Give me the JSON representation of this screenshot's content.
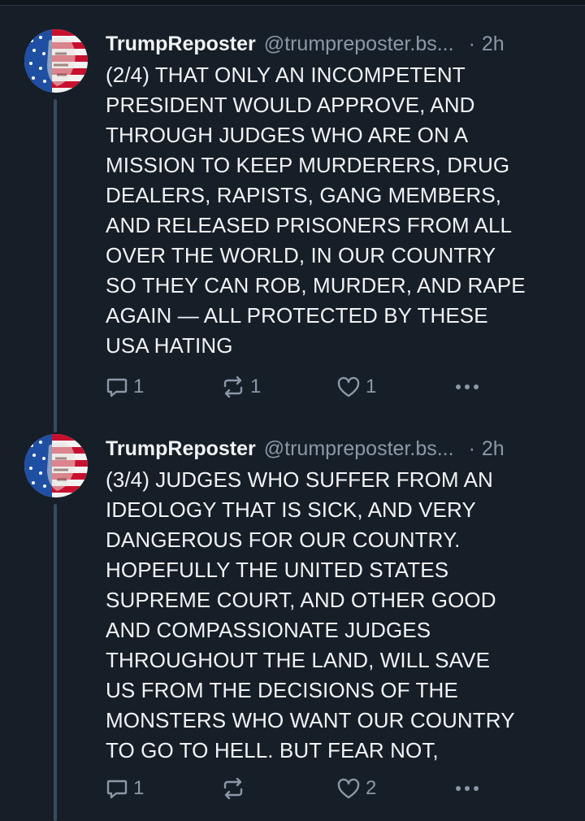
{
  "posts": [
    {
      "author": {
        "display_name": "TrumpReposter",
        "handle": "@trumpreposter.bs...",
        "avatar": "flag-portrait-avatar"
      },
      "separator": "·",
      "time": "2h",
      "text": "(2/4) THAT ONLY AN INCOMPETENT\nPRESIDENT WOULD APPROVE, AND\nTHROUGH JUDGES WHO ARE ON A\nMISSION TO KEEP MURDERERS, DRUG\nDEALERS, RAPISTS, GANG MEMBERS,\nAND RELEASED PRISONERS FROM ALL\nOVER THE WORLD, IN OUR COUNTRY\nSO THEY CAN ROB, MURDER, AND RAPE\nAGAIN — ALL PROTECTED BY THESE\nUSA HATING",
      "actions": {
        "replies": "1",
        "reposts": "1",
        "likes": "1",
        "more_icon": "more-horizontal-icon"
      }
    },
    {
      "author": {
        "display_name": "TrumpReposter",
        "handle": "@trumpreposter.bs...",
        "avatar": "flag-portrait-avatar"
      },
      "separator": "·",
      "time": "2h",
      "text": "(3/4) JUDGES WHO SUFFER FROM AN\nIDEOLOGY THAT IS SICK, AND VERY\nDANGEROUS FOR OUR COUNTRY.\nHOPEFULLY THE UNITED STATES\nSUPREME COURT, AND OTHER GOOD\nAND COMPASSIONATE JUDGES\nTHROUGHOUT THE LAND, WILL SAVE\nUS FROM THE DECISIONS OF THE\nMONSTERS WHO WANT OUR COUNTRY\nTO GO TO HELL. BUT FEAR NOT,",
      "actions": {
        "replies": "1",
        "reposts": "",
        "likes": "2",
        "more_icon": "more-horizontal-icon"
      }
    }
  ],
  "colors": {
    "background": "#161e27",
    "text_primary": "#f1f3f5",
    "text_secondary": "#8b98a8",
    "thread_line": "#3a4a5e",
    "flag_red": "#c8102e",
    "flag_blue": "#1f4fa3"
  }
}
